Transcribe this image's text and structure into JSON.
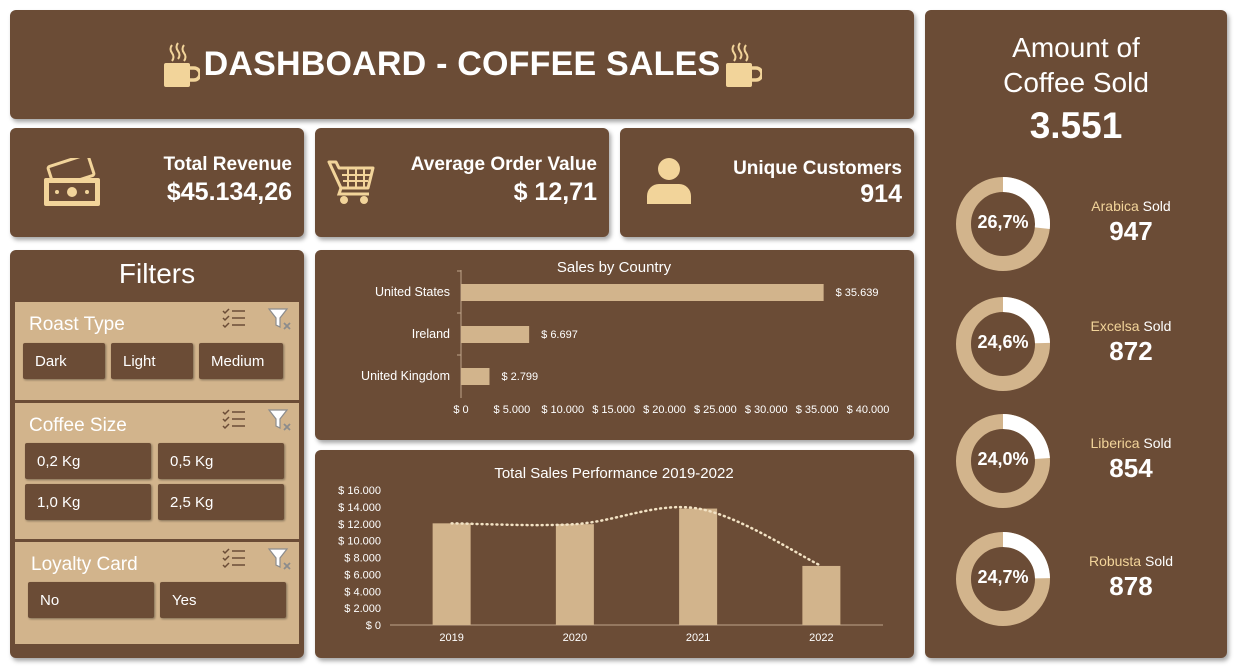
{
  "header": {
    "title": "DASHBOARD - COFFEE SALES"
  },
  "kpis": [
    {
      "label": "Total Revenue",
      "value": "$45.134,26",
      "icon": "money-icon"
    },
    {
      "label": "Average Order Value",
      "value": "$ 12,71",
      "icon": "shopping-cart-icon"
    },
    {
      "label": "Unique Customers",
      "value": "914",
      "icon": "user-icon"
    }
  ],
  "filters": {
    "title": "Filters",
    "slicers": [
      {
        "title": "Roast Type",
        "options": [
          "Dark",
          "Light",
          "Medium"
        ]
      },
      {
        "title": "Coffee Size",
        "options": [
          "0,2 Kg",
          "0,5 Kg",
          "1,0 Kg",
          "2,5 Kg"
        ]
      },
      {
        "title": "Loyalty Card",
        "options": [
          "No",
          "Yes"
        ]
      }
    ]
  },
  "amount_sold": {
    "title_line1": "Amount of",
    "title_line2": "Coffee Sold",
    "value": "3.551",
    "sold_word": "Sold",
    "types": [
      {
        "name": "Arabica",
        "percent_label": "26,7%",
        "percent": 26.7,
        "count": "947"
      },
      {
        "name": "Excelsa",
        "percent_label": "24,6%",
        "percent": 24.6,
        "count": "872"
      },
      {
        "name": "Liberica",
        "percent_label": "24,0%",
        "percent": 24.0,
        "count": "854"
      },
      {
        "name": "Robusta",
        "percent_label": "24,7%",
        "percent": 24.7,
        "count": "878"
      }
    ]
  },
  "colors": {
    "panel": "#6b4c36",
    "accent": "#d2b48c",
    "cream": "#f2d49a",
    "text": "#ffffff"
  },
  "chart_data": [
    {
      "type": "bar",
      "orientation": "horizontal",
      "title": "Sales by Country",
      "categories": [
        "United States",
        "Ireland",
        "United Kingdom"
      ],
      "values": [
        35639,
        6697,
        2799
      ],
      "data_labels": [
        "$ 35.639",
        "$ 6.697",
        "$ 2.799"
      ],
      "xlim": [
        0,
        40000
      ],
      "x_ticks": [
        0,
        5000,
        10000,
        15000,
        20000,
        25000,
        30000,
        35000,
        40000
      ],
      "x_tick_labels": [
        "$ 0",
        "$ 5.000",
        "$ 10.000",
        "$ 15.000",
        "$ 20.000",
        "$ 25.000",
        "$ 30.000",
        "$ 35.000",
        "$ 40.000"
      ],
      "grid": false
    },
    {
      "type": "bar",
      "title": "Total Sales Performance 2019-2022",
      "categories": [
        "2019",
        "2020",
        "2021",
        "2022"
      ],
      "values": [
        12050,
        11950,
        13800,
        7000
      ],
      "trendline": "dotted smooth",
      "ylim": [
        0,
        16000
      ],
      "y_ticks": [
        0,
        2000,
        4000,
        6000,
        8000,
        10000,
        12000,
        14000,
        16000
      ],
      "y_tick_labels": [
        "$ 0",
        "$ 2.000",
        "$ 4.000",
        "$ 6.000",
        "$ 8.000",
        "$ 10.000",
        "$ 12.000",
        "$ 14.000",
        "$ 16.000"
      ],
      "grid": false
    }
  ]
}
